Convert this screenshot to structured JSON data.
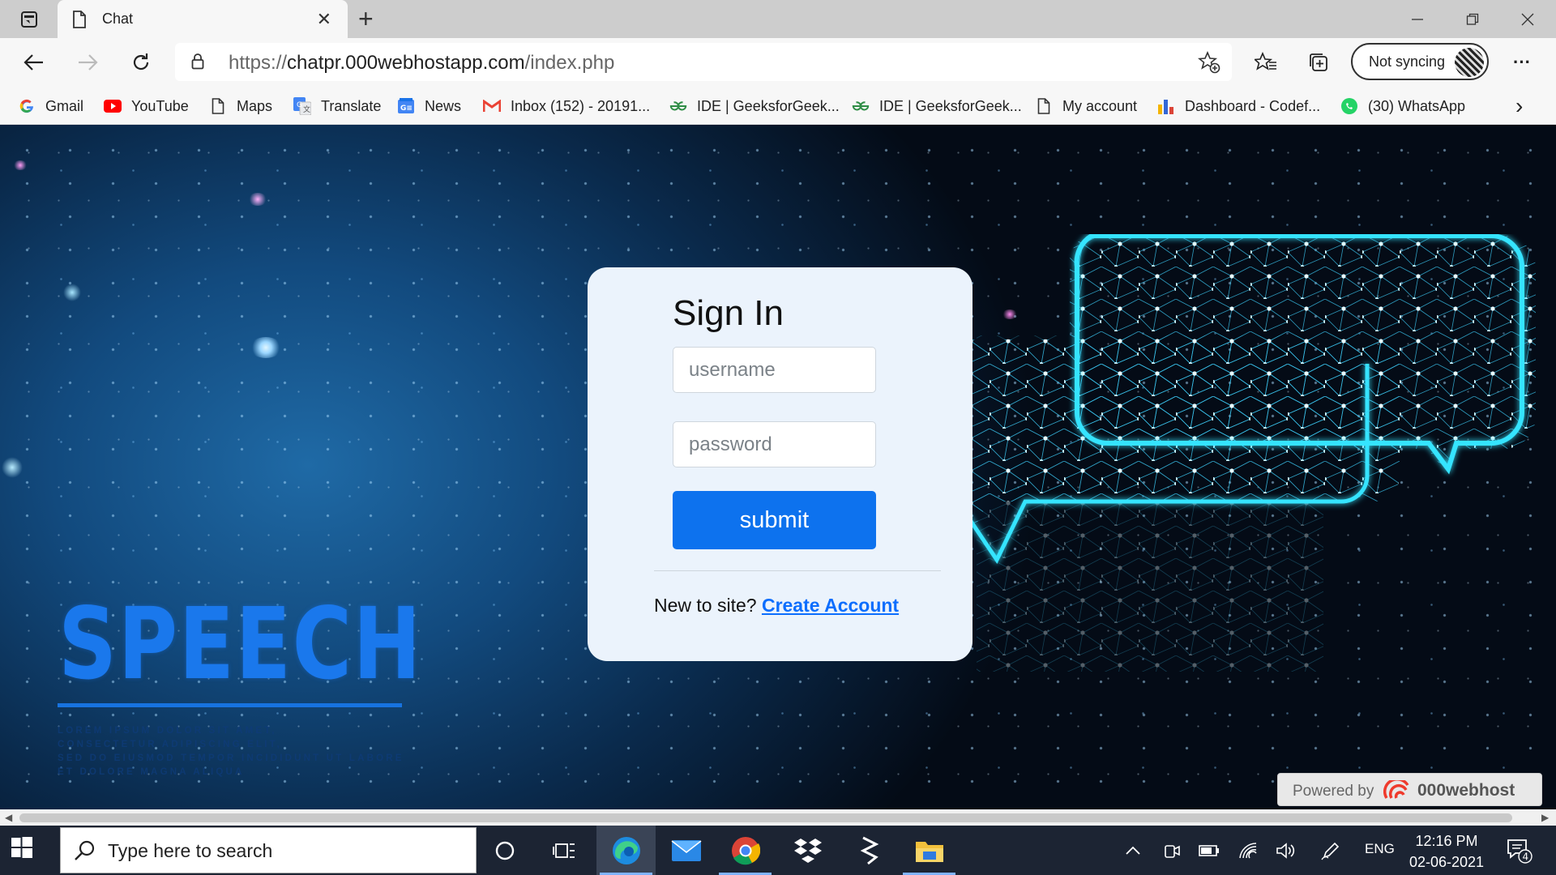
{
  "browser": {
    "tab": {
      "title": "Chat",
      "close": "✕"
    },
    "new_tab": "+",
    "window": {
      "minimize": "—",
      "restore": "❐",
      "close": "✕"
    },
    "address": {
      "prefix": "https://",
      "host": "chatpr.000webhostapp.com",
      "path": "/index.php"
    },
    "profile": {
      "label": "Not syncing"
    },
    "more": "···",
    "bookmarks": [
      {
        "label": "Gmail",
        "icon": "google-icon"
      },
      {
        "label": "YouTube",
        "icon": "youtube-icon"
      },
      {
        "label": "Maps",
        "icon": "page-icon"
      },
      {
        "label": "Translate",
        "icon": "translate-icon"
      },
      {
        "label": "News",
        "icon": "news-icon"
      },
      {
        "label": "Inbox (152) - 20191...",
        "icon": "gmail-icon"
      },
      {
        "label": "IDE | GeeksforGeek...",
        "icon": "geeksforgeeks-icon"
      },
      {
        "label": "IDE | GeeksforGeek...",
        "icon": "geeksforgeeks-icon"
      },
      {
        "label": "My account",
        "icon": "page-icon"
      },
      {
        "label": "Dashboard - Codef...",
        "icon": "chart-icon"
      },
      {
        "label": "(30) WhatsApp",
        "icon": "whatsapp-icon"
      }
    ],
    "bookmarks_overflow": "›"
  },
  "page": {
    "hero": {
      "title": "SPEECH",
      "subtitle_lines": [
        "LOREM IPSUM DOLOR SIT AMET,",
        "CONSECTETUR ADIPISCING ELIT,",
        "SED DO EIUSMOD TEMPOR INCIDIDUNT UT LABORE",
        "ET DOLORE MAGNA ALIQUA"
      ]
    },
    "signin": {
      "heading": "Sign In",
      "username": {
        "value": "",
        "placeholder": "username"
      },
      "password": {
        "value": "",
        "placeholder": "password"
      },
      "submit_label": "submit",
      "new_prompt": "New to site?",
      "create_link": "Create Account"
    },
    "powered": {
      "label": "Powered by",
      "brand": "000webhost"
    }
  },
  "taskbar": {
    "search_placeholder": "Type here to search",
    "apps": [
      "cortana-icon",
      "task-view-icon",
      "edge-icon",
      "mail-icon",
      "chrome-icon",
      "dropbox-icon",
      "sublime-icon",
      "file-explorer-icon"
    ],
    "active_app": "edge-icon",
    "language": "ENG",
    "time": "12:16 PM",
    "date": "02-06-2021",
    "notifications": "4"
  },
  "colors": {
    "accent": "#0d72ee",
    "link": "#0d6efd",
    "card": "#ebf3fc",
    "hero_title": "#1a78ec",
    "bubble_glow": "#34e4ff",
    "taskbar": "#1c2433"
  }
}
